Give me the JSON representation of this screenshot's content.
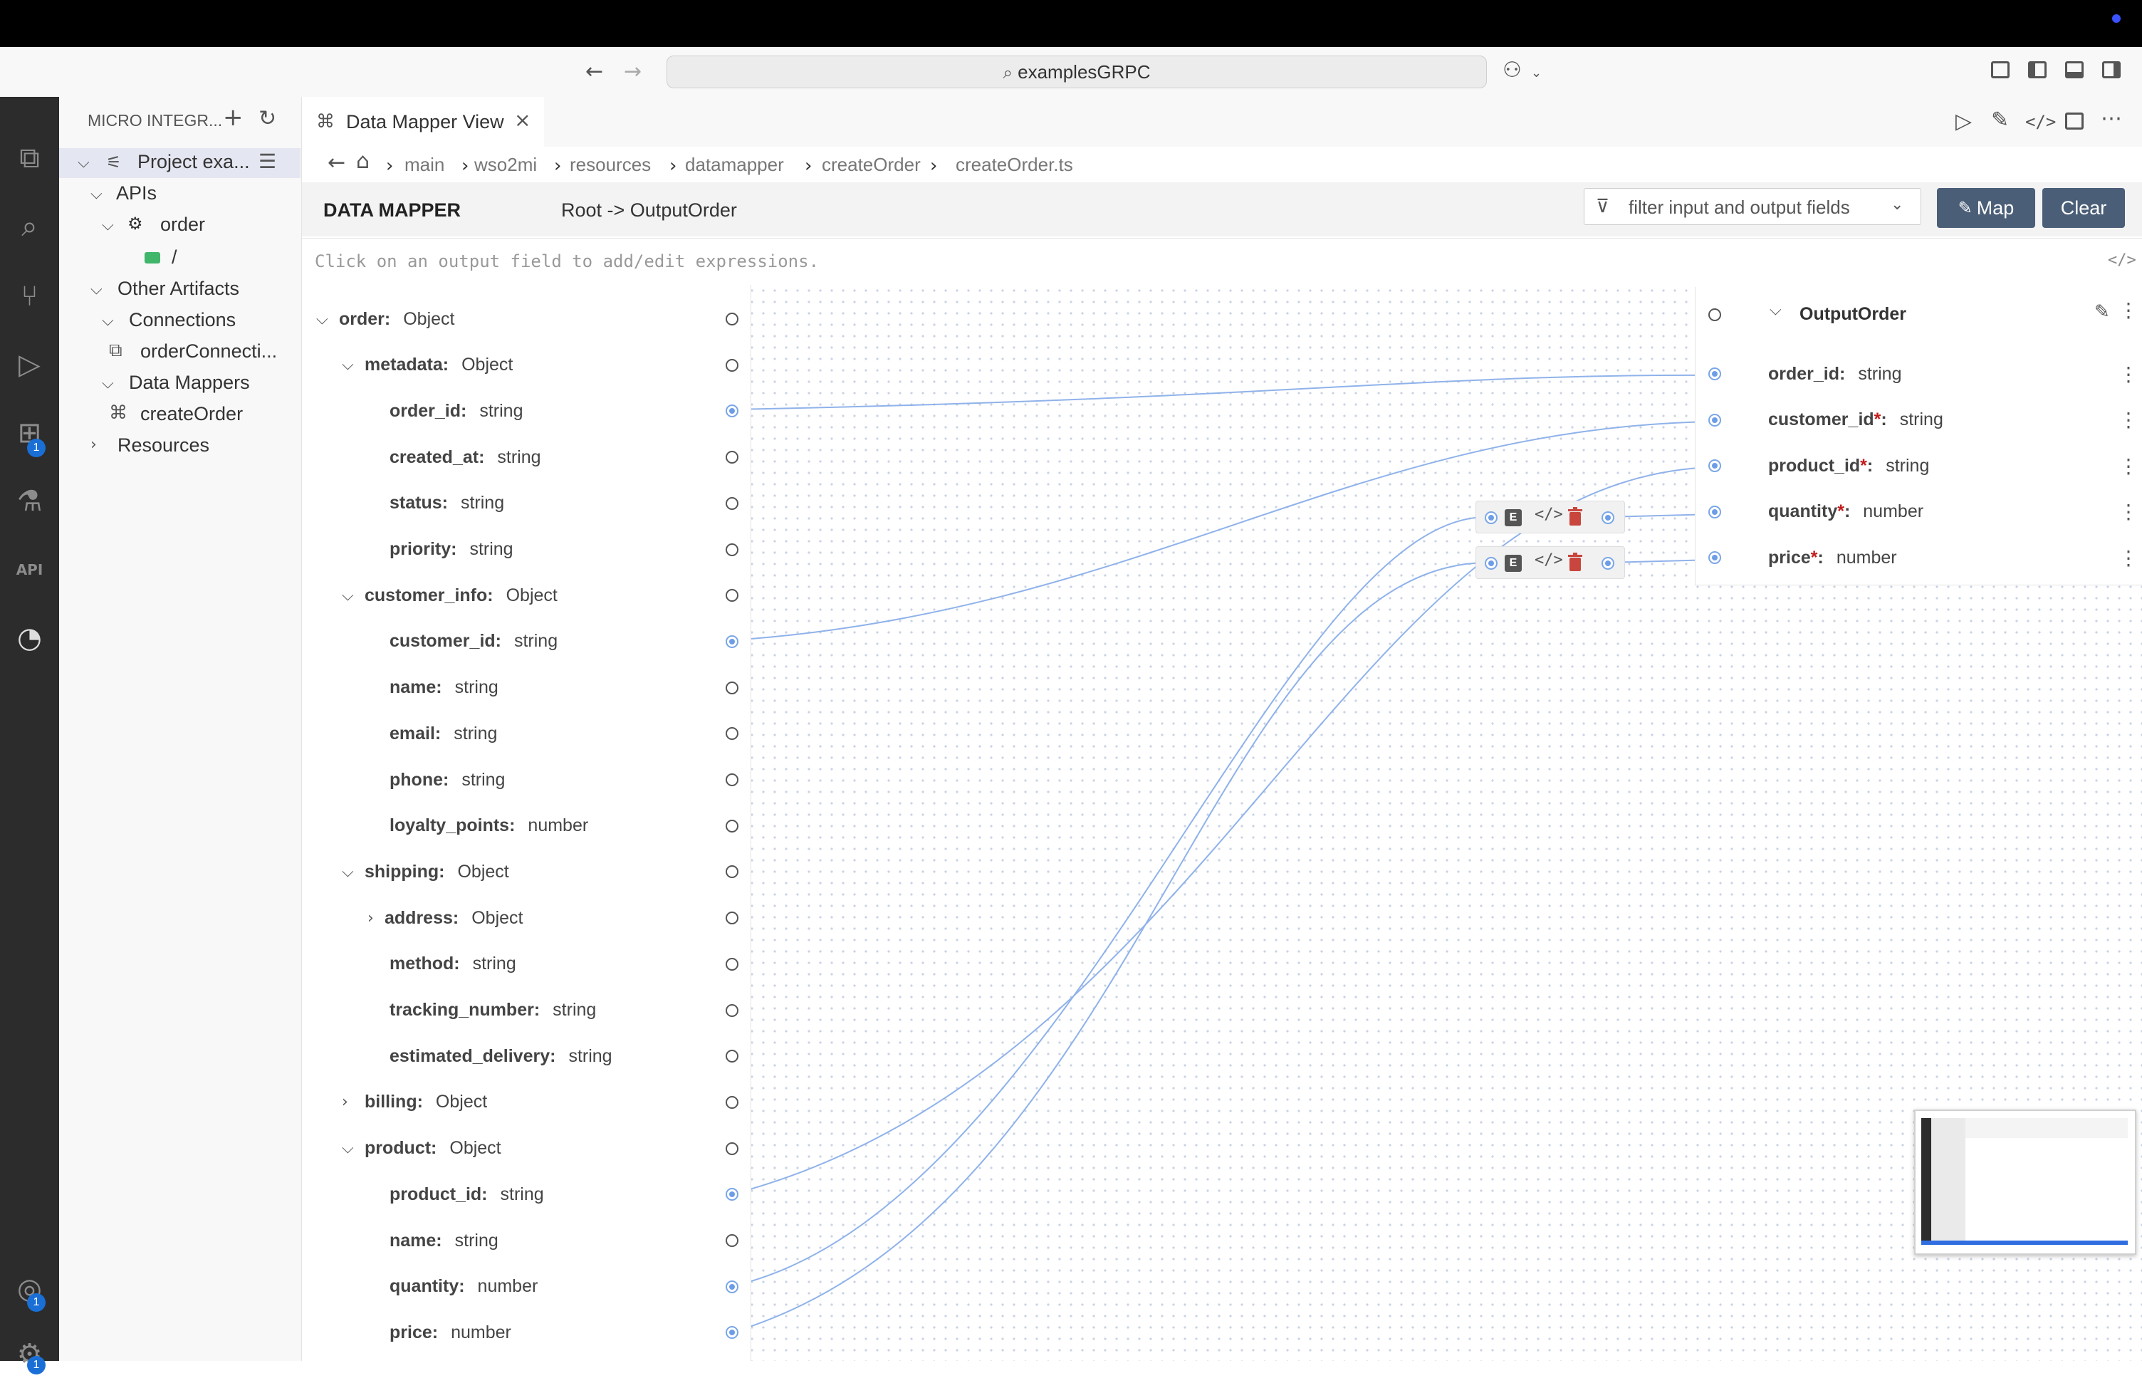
{
  "window": {
    "search_text": "examplesGRPC"
  },
  "sidebar": {
    "title": "MICRO INTEGR...",
    "tree": {
      "project": "Project exa...",
      "apis": "APIs",
      "order": "order",
      "resource_path": "/",
      "other_artifacts": "Other Artifacts",
      "connections": "Connections",
      "connection_item": "orderConnecti...",
      "data_mappers": "Data Mappers",
      "data_mapper_item": "createOrder",
      "resources": "Resources"
    }
  },
  "activity_badges": {
    "extensions": "1",
    "accounts": "1",
    "manage": "1"
  },
  "editor": {
    "tab_label": "Data Mapper View",
    "breadcrumb": [
      "main",
      "wso2mi",
      "resources",
      "datamapper",
      "createOrder",
      "createOrder.ts"
    ]
  },
  "data_mapper": {
    "title": "DATA MAPPER",
    "path": "Root -> OutputOrder",
    "filter_placeholder": "filter input and output fields",
    "map_button": "Map",
    "clear_button": "Clear",
    "expression_placeholder": "Click on an output field to add/edit expressions.",
    "input_fields": [
      {
        "name": "order:",
        "type": "Object",
        "level": 0,
        "expand": "open",
        "connected": false
      },
      {
        "name": "metadata:",
        "type": "Object",
        "level": 1,
        "expand": "open",
        "connected": false
      },
      {
        "name": "order_id:",
        "type": "string",
        "level": 2,
        "expand": "none",
        "connected": true
      },
      {
        "name": "created_at:",
        "type": "string",
        "level": 2,
        "expand": "none",
        "connected": false
      },
      {
        "name": "status:",
        "type": "string",
        "level": 2,
        "expand": "none",
        "connected": false
      },
      {
        "name": "priority:",
        "type": "string",
        "level": 2,
        "expand": "none",
        "connected": false
      },
      {
        "name": "customer_info:",
        "type": "Object",
        "level": 1,
        "expand": "open",
        "connected": false
      },
      {
        "name": "customer_id:",
        "type": "string",
        "level": 2,
        "expand": "none",
        "connected": true
      },
      {
        "name": "name:",
        "type": "string",
        "level": 2,
        "expand": "none",
        "connected": false
      },
      {
        "name": "email:",
        "type": "string",
        "level": 2,
        "expand": "none",
        "connected": false
      },
      {
        "name": "phone:",
        "type": "string",
        "level": 2,
        "expand": "none",
        "connected": false
      },
      {
        "name": "loyalty_points:",
        "type": "number",
        "level": 2,
        "expand": "none",
        "connected": false
      },
      {
        "name": "shipping:",
        "type": "Object",
        "level": 1,
        "expand": "open",
        "connected": false
      },
      {
        "name": "address:",
        "type": "Object",
        "level": 2,
        "expand": "closed",
        "connected": false
      },
      {
        "name": "method:",
        "type": "string",
        "level": 2,
        "expand": "none",
        "connected": false
      },
      {
        "name": "tracking_number:",
        "type": "string",
        "level": 2,
        "expand": "none",
        "connected": false
      },
      {
        "name": "estimated_delivery:",
        "type": "string",
        "level": 2,
        "expand": "none",
        "connected": false
      },
      {
        "name": "billing:",
        "type": "Object",
        "level": 1,
        "expand": "closed",
        "connected": false
      },
      {
        "name": "product:",
        "type": "Object",
        "level": 1,
        "expand": "open",
        "connected": false
      },
      {
        "name": "product_id:",
        "type": "string",
        "level": 2,
        "expand": "none",
        "connected": true
      },
      {
        "name": "name:",
        "type": "string",
        "level": 2,
        "expand": "none",
        "connected": false
      },
      {
        "name": "quantity:",
        "type": "number",
        "level": 2,
        "expand": "none",
        "connected": true
      },
      {
        "name": "price:",
        "type": "number",
        "level": 2,
        "expand": "none",
        "connected": true
      }
    ],
    "output": {
      "title": "OutputOrder",
      "fields": [
        {
          "name": "order_id",
          "required": false,
          "type": "string"
        },
        {
          "name": "customer_id",
          "required": true,
          "type": "string"
        },
        {
          "name": "product_id",
          "required": true,
          "type": "string"
        },
        {
          "name": "quantity",
          "required": true,
          "type": "number"
        },
        {
          "name": "price",
          "required": true,
          "type": "number"
        }
      ]
    }
  }
}
